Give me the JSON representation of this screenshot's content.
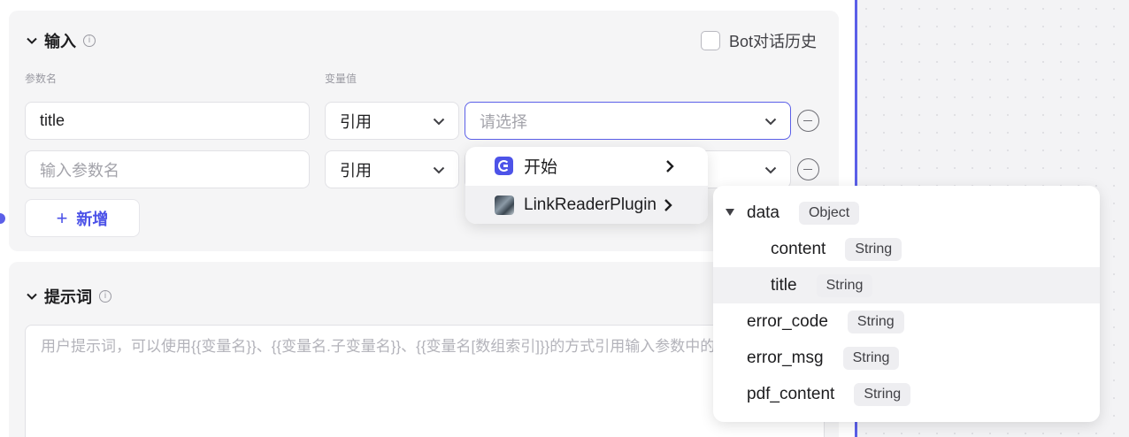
{
  "input_section": {
    "title": "输入",
    "info_glyph": "i",
    "bot_history_label": "Bot对话历史",
    "param_name_header": "参数名",
    "var_value_header": "变量值",
    "rows": [
      {
        "name": "title",
        "ref_type": "引用",
        "select_placeholder": "请选择"
      },
      {
        "name_placeholder": "输入参数名",
        "ref_type": "引用"
      }
    ],
    "add_label": "新增",
    "add_glyph": "+"
  },
  "prompt_section": {
    "title": "提示词",
    "info_glyph": "i",
    "placeholder": "用户提示词，可以使用{{变量名}}、{{变量名.子变量名}}、{{变量名[数组索引]}}的方式引用输入参数中的变量"
  },
  "node_menu": {
    "items": [
      {
        "label": "开始",
        "icon": "start-node-icon"
      },
      {
        "label": "LinkReaderPlugin",
        "icon": "plugin-image-icon"
      }
    ]
  },
  "variable_menu": {
    "items": [
      {
        "name": "data",
        "type": "Object",
        "expanded": true,
        "depth": 0
      },
      {
        "name": "content",
        "type": "String",
        "depth": 1
      },
      {
        "name": "title",
        "type": "String",
        "depth": 1,
        "highlighted": true
      },
      {
        "name": "error_code",
        "type": "String",
        "depth": 0
      },
      {
        "name": "error_msg",
        "type": "String",
        "depth": 0
      },
      {
        "name": "pdf_content",
        "type": "String",
        "depth": 0
      }
    ]
  },
  "colors": {
    "accent": "#4d53e8",
    "canvas_divider": "#5b5fe8",
    "card_bg": "#f5f5f6"
  }
}
